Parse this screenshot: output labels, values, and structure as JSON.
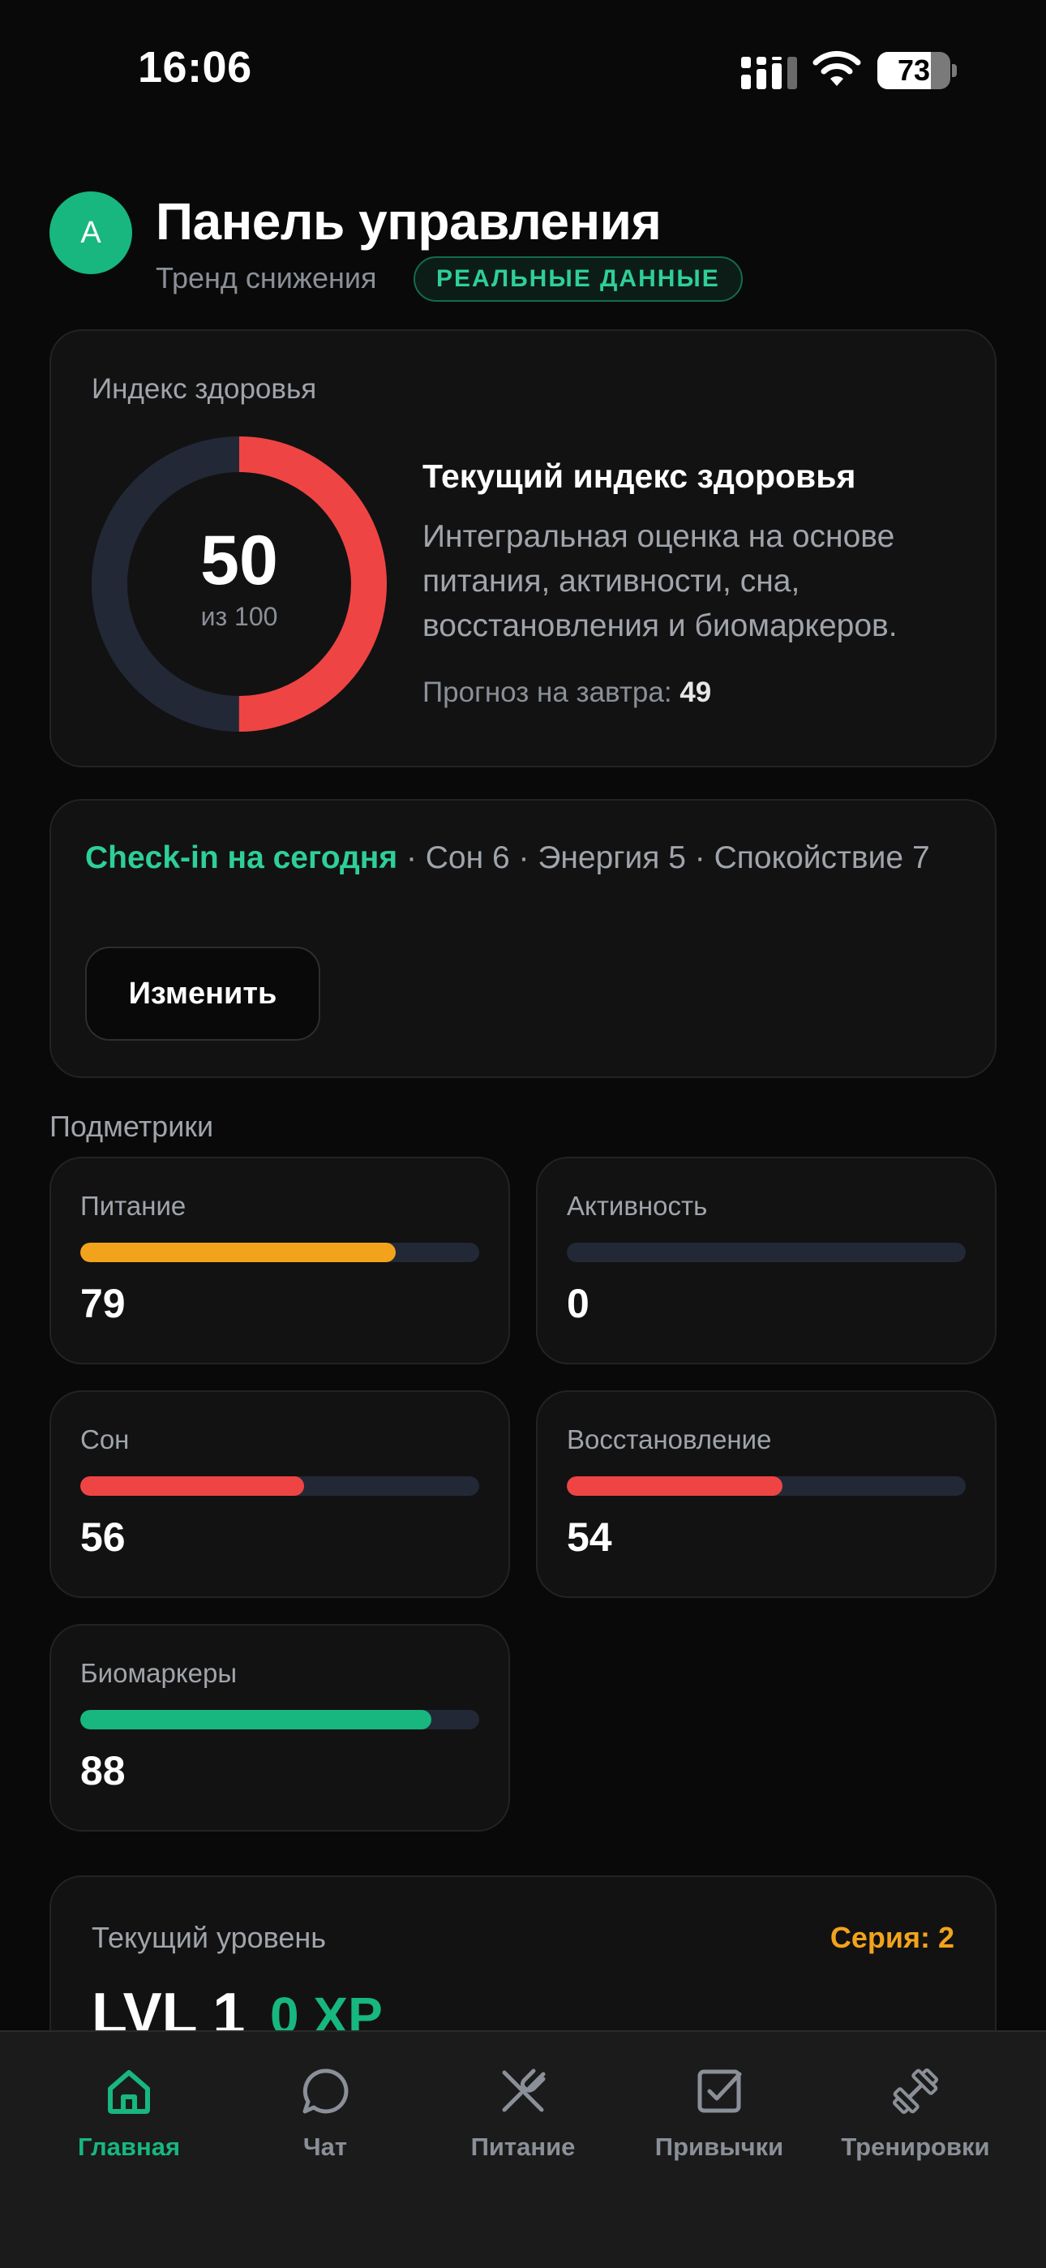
{
  "status_bar": {
    "time": "16:06",
    "battery_level": 73,
    "battery_text": "73"
  },
  "header": {
    "avatar_initial": "A",
    "title": "Панель управления",
    "trend": "Тренд снижения",
    "badge": "РЕАЛЬНЫЕ ДАННЫЕ"
  },
  "health_index": {
    "card_title": "Индекс здоровья",
    "value": 50,
    "value_text": "50",
    "max_text": "из 100",
    "heading": "Текущий индекс здоровья",
    "description": "Интегральная оценка на основе питания, активности, сна, восстановления и биомаркеров.",
    "forecast_label": "Прогноз на завтра:",
    "forecast_value": "49",
    "colors": {
      "progress": "#ef4444",
      "track": "#222836",
      "inner": "#121212"
    }
  },
  "checkin": {
    "title": "Check-in на сегодня",
    "details": " · Сон 6 · Энергия 5 · Спокойствие 7",
    "edit_label": "Изменить"
  },
  "submetrics": {
    "section_label": "Подметрики",
    "items": [
      {
        "label": "Питание",
        "value": 79,
        "value_text": "79",
        "color": "#f2a31c"
      },
      {
        "label": "Активность",
        "value": 0,
        "value_text": "0",
        "color": "#222836"
      },
      {
        "label": "Сон",
        "value": 56,
        "value_text": "56",
        "color": "#ef4444"
      },
      {
        "label": "Восстановление",
        "value": 54,
        "value_text": "54",
        "color": "#ef4444"
      },
      {
        "label": "Биомаркеры",
        "value": 88,
        "value_text": "88",
        "color": "#17b77f"
      }
    ]
  },
  "level": {
    "label": "Текущий уровень",
    "streak": "Серия: 2",
    "level_text": "LVL 1",
    "xp_text": "0 XP"
  },
  "tab_bar": {
    "tabs": [
      {
        "label": "Главная",
        "icon": "home-icon",
        "active": true
      },
      {
        "label": "Чат",
        "icon": "chat-icon",
        "active": false
      },
      {
        "label": "Питание",
        "icon": "fork-knife-icon",
        "active": false
      },
      {
        "label": "Привычки",
        "icon": "checkbox-icon",
        "active": false
      },
      {
        "label": "Тренировки",
        "icon": "dumbbell-icon",
        "active": false
      }
    ],
    "colors": {
      "active": "#17b77f",
      "inactive": "#8a8f98"
    }
  }
}
